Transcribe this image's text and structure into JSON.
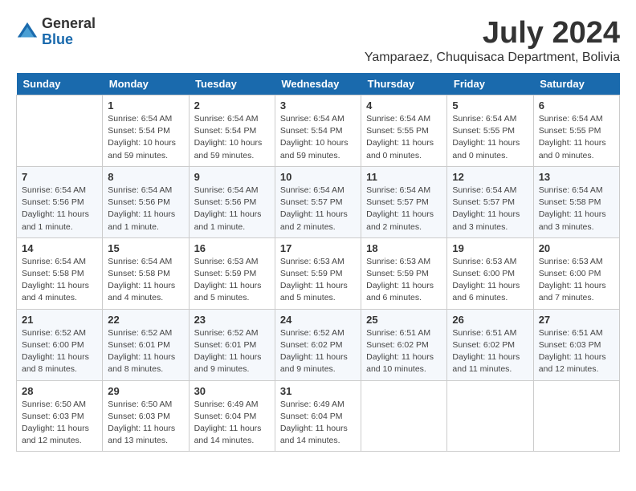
{
  "header": {
    "logo_general": "General",
    "logo_blue": "Blue",
    "month_year": "July 2024",
    "location": "Yamparaez, Chuquisaca Department, Bolivia"
  },
  "days_of_week": [
    "Sunday",
    "Monday",
    "Tuesday",
    "Wednesday",
    "Thursday",
    "Friday",
    "Saturday"
  ],
  "weeks": [
    [
      {
        "day": "",
        "info": ""
      },
      {
        "day": "1",
        "info": "Sunrise: 6:54 AM\nSunset: 5:54 PM\nDaylight: 10 hours\nand 59 minutes."
      },
      {
        "day": "2",
        "info": "Sunrise: 6:54 AM\nSunset: 5:54 PM\nDaylight: 10 hours\nand 59 minutes."
      },
      {
        "day": "3",
        "info": "Sunrise: 6:54 AM\nSunset: 5:54 PM\nDaylight: 10 hours\nand 59 minutes."
      },
      {
        "day": "4",
        "info": "Sunrise: 6:54 AM\nSunset: 5:55 PM\nDaylight: 11 hours\nand 0 minutes."
      },
      {
        "day": "5",
        "info": "Sunrise: 6:54 AM\nSunset: 5:55 PM\nDaylight: 11 hours\nand 0 minutes."
      },
      {
        "day": "6",
        "info": "Sunrise: 6:54 AM\nSunset: 5:55 PM\nDaylight: 11 hours\nand 0 minutes."
      }
    ],
    [
      {
        "day": "7",
        "info": "Sunrise: 6:54 AM\nSunset: 5:56 PM\nDaylight: 11 hours\nand 1 minute."
      },
      {
        "day": "8",
        "info": "Sunrise: 6:54 AM\nSunset: 5:56 PM\nDaylight: 11 hours\nand 1 minute."
      },
      {
        "day": "9",
        "info": "Sunrise: 6:54 AM\nSunset: 5:56 PM\nDaylight: 11 hours\nand 1 minute."
      },
      {
        "day": "10",
        "info": "Sunrise: 6:54 AM\nSunset: 5:57 PM\nDaylight: 11 hours\nand 2 minutes."
      },
      {
        "day": "11",
        "info": "Sunrise: 6:54 AM\nSunset: 5:57 PM\nDaylight: 11 hours\nand 2 minutes."
      },
      {
        "day": "12",
        "info": "Sunrise: 6:54 AM\nSunset: 5:57 PM\nDaylight: 11 hours\nand 3 minutes."
      },
      {
        "day": "13",
        "info": "Sunrise: 6:54 AM\nSunset: 5:58 PM\nDaylight: 11 hours\nand 3 minutes."
      }
    ],
    [
      {
        "day": "14",
        "info": "Sunrise: 6:54 AM\nSunset: 5:58 PM\nDaylight: 11 hours\nand 4 minutes."
      },
      {
        "day": "15",
        "info": "Sunrise: 6:54 AM\nSunset: 5:58 PM\nDaylight: 11 hours\nand 4 minutes."
      },
      {
        "day": "16",
        "info": "Sunrise: 6:53 AM\nSunset: 5:59 PM\nDaylight: 11 hours\nand 5 minutes."
      },
      {
        "day": "17",
        "info": "Sunrise: 6:53 AM\nSunset: 5:59 PM\nDaylight: 11 hours\nand 5 minutes."
      },
      {
        "day": "18",
        "info": "Sunrise: 6:53 AM\nSunset: 5:59 PM\nDaylight: 11 hours\nand 6 minutes."
      },
      {
        "day": "19",
        "info": "Sunrise: 6:53 AM\nSunset: 6:00 PM\nDaylight: 11 hours\nand 6 minutes."
      },
      {
        "day": "20",
        "info": "Sunrise: 6:53 AM\nSunset: 6:00 PM\nDaylight: 11 hours\nand 7 minutes."
      }
    ],
    [
      {
        "day": "21",
        "info": "Sunrise: 6:52 AM\nSunset: 6:00 PM\nDaylight: 11 hours\nand 8 minutes."
      },
      {
        "day": "22",
        "info": "Sunrise: 6:52 AM\nSunset: 6:01 PM\nDaylight: 11 hours\nand 8 minutes."
      },
      {
        "day": "23",
        "info": "Sunrise: 6:52 AM\nSunset: 6:01 PM\nDaylight: 11 hours\nand 9 minutes."
      },
      {
        "day": "24",
        "info": "Sunrise: 6:52 AM\nSunset: 6:02 PM\nDaylight: 11 hours\nand 9 minutes."
      },
      {
        "day": "25",
        "info": "Sunrise: 6:51 AM\nSunset: 6:02 PM\nDaylight: 11 hours\nand 10 minutes."
      },
      {
        "day": "26",
        "info": "Sunrise: 6:51 AM\nSunset: 6:02 PM\nDaylight: 11 hours\nand 11 minutes."
      },
      {
        "day": "27",
        "info": "Sunrise: 6:51 AM\nSunset: 6:03 PM\nDaylight: 11 hours\nand 12 minutes."
      }
    ],
    [
      {
        "day": "28",
        "info": "Sunrise: 6:50 AM\nSunset: 6:03 PM\nDaylight: 11 hours\nand 12 minutes."
      },
      {
        "day": "29",
        "info": "Sunrise: 6:50 AM\nSunset: 6:03 PM\nDaylight: 11 hours\nand 13 minutes."
      },
      {
        "day": "30",
        "info": "Sunrise: 6:49 AM\nSunset: 6:04 PM\nDaylight: 11 hours\nand 14 minutes."
      },
      {
        "day": "31",
        "info": "Sunrise: 6:49 AM\nSunset: 6:04 PM\nDaylight: 11 hours\nand 14 minutes."
      },
      {
        "day": "",
        "info": ""
      },
      {
        "day": "",
        "info": ""
      },
      {
        "day": "",
        "info": ""
      }
    ]
  ]
}
